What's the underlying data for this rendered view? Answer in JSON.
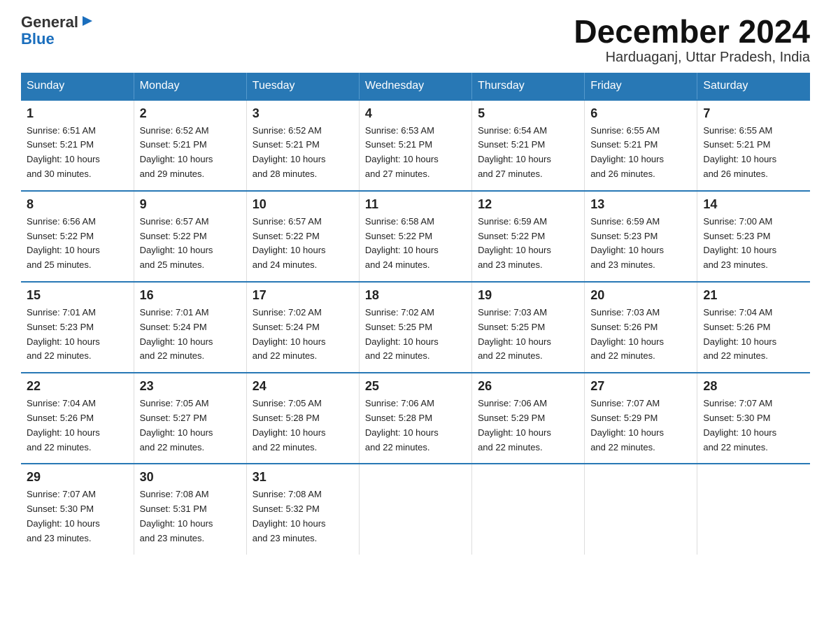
{
  "logo": {
    "line1": "General",
    "triangle": "▶",
    "line2": "Blue"
  },
  "title": "December 2024",
  "subtitle": "Harduaganj, Uttar Pradesh, India",
  "days_header": [
    "Sunday",
    "Monday",
    "Tuesday",
    "Wednesday",
    "Thursday",
    "Friday",
    "Saturday"
  ],
  "weeks": [
    [
      {
        "num": "1",
        "sunrise": "6:51 AM",
        "sunset": "5:21 PM",
        "daylight": "10 hours and 30 minutes."
      },
      {
        "num": "2",
        "sunrise": "6:52 AM",
        "sunset": "5:21 PM",
        "daylight": "10 hours and 29 minutes."
      },
      {
        "num": "3",
        "sunrise": "6:52 AM",
        "sunset": "5:21 PM",
        "daylight": "10 hours and 28 minutes."
      },
      {
        "num": "4",
        "sunrise": "6:53 AM",
        "sunset": "5:21 PM",
        "daylight": "10 hours and 27 minutes."
      },
      {
        "num": "5",
        "sunrise": "6:54 AM",
        "sunset": "5:21 PM",
        "daylight": "10 hours and 27 minutes."
      },
      {
        "num": "6",
        "sunrise": "6:55 AM",
        "sunset": "5:21 PM",
        "daylight": "10 hours and 26 minutes."
      },
      {
        "num": "7",
        "sunrise": "6:55 AM",
        "sunset": "5:21 PM",
        "daylight": "10 hours and 26 minutes."
      }
    ],
    [
      {
        "num": "8",
        "sunrise": "6:56 AM",
        "sunset": "5:22 PM",
        "daylight": "10 hours and 25 minutes."
      },
      {
        "num": "9",
        "sunrise": "6:57 AM",
        "sunset": "5:22 PM",
        "daylight": "10 hours and 25 minutes."
      },
      {
        "num": "10",
        "sunrise": "6:57 AM",
        "sunset": "5:22 PM",
        "daylight": "10 hours and 24 minutes."
      },
      {
        "num": "11",
        "sunrise": "6:58 AM",
        "sunset": "5:22 PM",
        "daylight": "10 hours and 24 minutes."
      },
      {
        "num": "12",
        "sunrise": "6:59 AM",
        "sunset": "5:22 PM",
        "daylight": "10 hours and 23 minutes."
      },
      {
        "num": "13",
        "sunrise": "6:59 AM",
        "sunset": "5:23 PM",
        "daylight": "10 hours and 23 minutes."
      },
      {
        "num": "14",
        "sunrise": "7:00 AM",
        "sunset": "5:23 PM",
        "daylight": "10 hours and 23 minutes."
      }
    ],
    [
      {
        "num": "15",
        "sunrise": "7:01 AM",
        "sunset": "5:23 PM",
        "daylight": "10 hours and 22 minutes."
      },
      {
        "num": "16",
        "sunrise": "7:01 AM",
        "sunset": "5:24 PM",
        "daylight": "10 hours and 22 minutes."
      },
      {
        "num": "17",
        "sunrise": "7:02 AM",
        "sunset": "5:24 PM",
        "daylight": "10 hours and 22 minutes."
      },
      {
        "num": "18",
        "sunrise": "7:02 AM",
        "sunset": "5:25 PM",
        "daylight": "10 hours and 22 minutes."
      },
      {
        "num": "19",
        "sunrise": "7:03 AM",
        "sunset": "5:25 PM",
        "daylight": "10 hours and 22 minutes."
      },
      {
        "num": "20",
        "sunrise": "7:03 AM",
        "sunset": "5:26 PM",
        "daylight": "10 hours and 22 minutes."
      },
      {
        "num": "21",
        "sunrise": "7:04 AM",
        "sunset": "5:26 PM",
        "daylight": "10 hours and 22 minutes."
      }
    ],
    [
      {
        "num": "22",
        "sunrise": "7:04 AM",
        "sunset": "5:26 PM",
        "daylight": "10 hours and 22 minutes."
      },
      {
        "num": "23",
        "sunrise": "7:05 AM",
        "sunset": "5:27 PM",
        "daylight": "10 hours and 22 minutes."
      },
      {
        "num": "24",
        "sunrise": "7:05 AM",
        "sunset": "5:28 PM",
        "daylight": "10 hours and 22 minutes."
      },
      {
        "num": "25",
        "sunrise": "7:06 AM",
        "sunset": "5:28 PM",
        "daylight": "10 hours and 22 minutes."
      },
      {
        "num": "26",
        "sunrise": "7:06 AM",
        "sunset": "5:29 PM",
        "daylight": "10 hours and 22 minutes."
      },
      {
        "num": "27",
        "sunrise": "7:07 AM",
        "sunset": "5:29 PM",
        "daylight": "10 hours and 22 minutes."
      },
      {
        "num": "28",
        "sunrise": "7:07 AM",
        "sunset": "5:30 PM",
        "daylight": "10 hours and 22 minutes."
      }
    ],
    [
      {
        "num": "29",
        "sunrise": "7:07 AM",
        "sunset": "5:30 PM",
        "daylight": "10 hours and 23 minutes."
      },
      {
        "num": "30",
        "sunrise": "7:08 AM",
        "sunset": "5:31 PM",
        "daylight": "10 hours and 23 minutes."
      },
      {
        "num": "31",
        "sunrise": "7:08 AM",
        "sunset": "5:32 PM",
        "daylight": "10 hours and 23 minutes."
      },
      null,
      null,
      null,
      null
    ]
  ],
  "labels": {
    "sunrise": "Sunrise:",
    "sunset": "Sunset:",
    "daylight": "Daylight:"
  }
}
